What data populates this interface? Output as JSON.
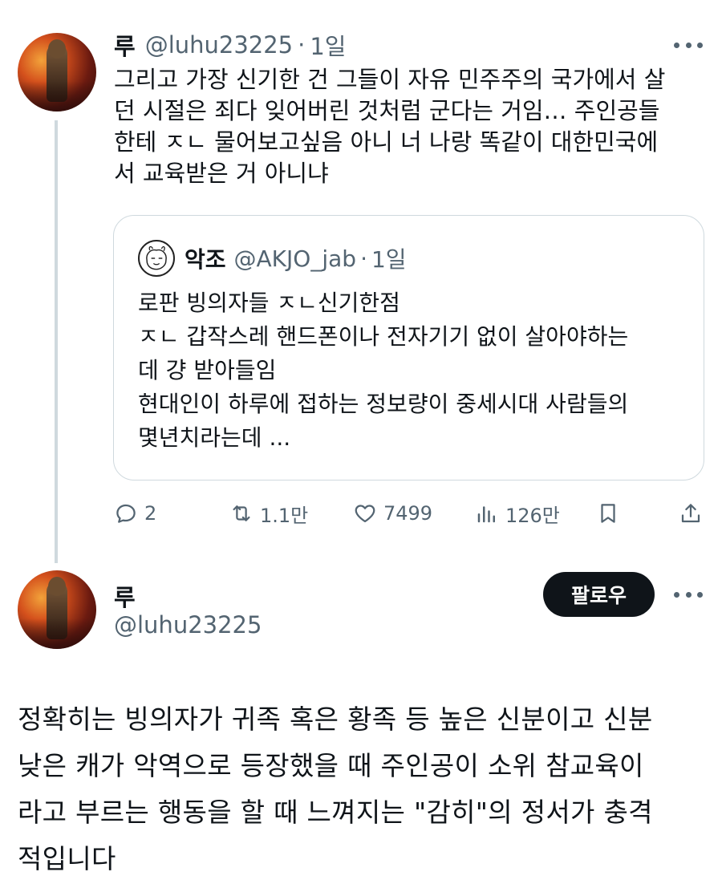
{
  "thread_tweet": {
    "author_name": "루",
    "handle": "@luhu23225",
    "separator": "·",
    "time": "1일",
    "lines": [
      "그리고 가장 신기한 건 그들이 자유 민주주의 국가에서 살",
      "던 시절은 죄다 잊어버린 것처럼 군다는 거임… 주인공들",
      "한테 ㅈㄴ 물어보고싶음 아니 너 나랑 똑같이 대한민국에",
      "서 교육받은 거 아니냐"
    ],
    "quote": {
      "author_name": "악조",
      "handle": "@AKJO_jab",
      "separator": "·",
      "time": "1일",
      "lines": [
        "로판 빙의자들 ㅈㄴ신기한점",
        "ㅈㄴ 갑작스레 핸드폰이나 전자기기 없이 살아야하는",
        "데 걍 받아들임",
        "현대인이 하루에 접하는 정보량이 중세시대 사람들의",
        "몇년치라는데 ..."
      ]
    },
    "actions": {
      "replies": "2",
      "retweets": "1.1만",
      "likes": "7499",
      "views": "126만"
    }
  },
  "main_tweet": {
    "author_name": "루",
    "handle": "@luhu23225",
    "follow_label": "팔로우",
    "lines": [
      "정확히는 빙의자가 귀족 혹은 황족 등 높은 신분이고 신분",
      "낮은 캐가 악역으로 등장했을 때 주인공이 소위 참교육이",
      "라고 부르는 행동을 할 때 느껴지는 \"감히\"의 정서가 충격",
      "적입니다"
    ]
  },
  "icons": [
    "more-icon",
    "reply-icon",
    "retweet-icon",
    "like-icon",
    "views-icon",
    "bookmark-icon",
    "share-icon"
  ]
}
